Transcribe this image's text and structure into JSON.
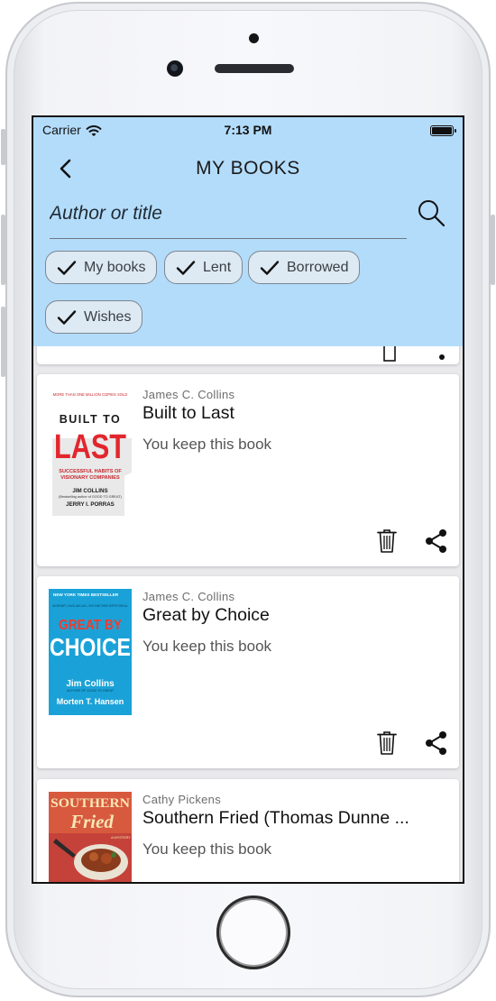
{
  "status_bar": {
    "carrier": "Carrier",
    "time": "7:13 PM"
  },
  "header": {
    "title": "MY BOOKS",
    "search_placeholder": "Author or title",
    "filters": [
      {
        "label": "My books",
        "checked": true
      },
      {
        "label": "Lent",
        "checked": true
      },
      {
        "label": "Borrowed",
        "checked": true
      },
      {
        "label": "Wishes",
        "checked": true
      }
    ]
  },
  "books": [
    {
      "author": "James C. Collins",
      "title": "Built to Last",
      "status": "You keep this book",
      "cover": {
        "top_line": "MORE THAN ONE MILLION COPIES SOLD",
        "line1": "BUILT TO",
        "line2": "LAST",
        "subtitle1": "SUCCESSFUL HABITS OF",
        "subtitle2": "VISIONARY COMPANIES",
        "author1": "JIM COLLINS",
        "author1_note": "(Bestselling author of GOOD TO GREAT)",
        "author2": "JERRY I. PORRAS"
      }
    },
    {
      "author": "James C. Collins",
      "title": "Great by Choice",
      "status": "You keep this book",
      "cover": {
        "top_line": "NEW YORK TIMES BESTSELLER",
        "tagline": "UNCERTAINTY, CHAOS, AND LUCK— WHY SOME THRIVE DESPITE THEM ALL",
        "line1": "GREAT BY",
        "line2": "CHOICE",
        "author1": "Jim Collins",
        "author1_note": "AUTHOR OF GOOD TO GREAT",
        "author2": "Morten T. Hansen"
      }
    },
    {
      "author": "Cathy Pickens",
      "title": "Southern Fried (Thomas Dunne ...",
      "status": "You keep this book",
      "cover": {
        "line1": "SOUTHERN",
        "line2": "Fried",
        "tag": "A MYSTERY"
      }
    }
  ],
  "colors": {
    "header_bg": "#b3dcfb",
    "chip_bg": "#dde9f3",
    "card_bg": "#ffffff",
    "list_bg": "#e9e9ec"
  },
  "icons": [
    "back-arrow-icon",
    "search-icon",
    "check-icon",
    "trash-icon",
    "share-icon",
    "wifi-icon",
    "battery-icon"
  ]
}
